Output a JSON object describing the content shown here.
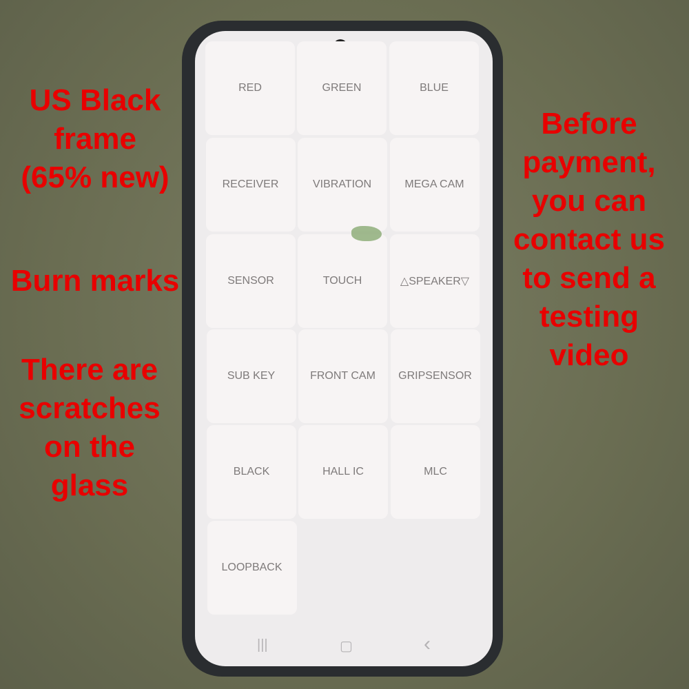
{
  "grid": [
    "RED",
    "GREEN",
    "BLUE",
    "RECEIVER",
    "VIBRATION",
    "MEGA CAM",
    "SENSOR",
    "TOUCH",
    "△SPEAKER▽",
    "SUB KEY",
    "FRONT CAM",
    "GRIPSENSOR",
    "BLACK",
    "HALL IC",
    "MLC",
    "LOOPBACK"
  ],
  "nav": {
    "recents": "|||",
    "home": "▢",
    "back": "‹"
  },
  "notes": {
    "frame": [
      "US Black",
      "frame",
      "(65% new)"
    ],
    "burn": "Burn marks",
    "scratches": [
      "There are",
      "scratches",
      "on the",
      "glass"
    ],
    "payment": [
      "Before",
      "payment,",
      "you can",
      "contact us",
      "to send a",
      "testing",
      "video"
    ]
  },
  "colors": {
    "annotation": "#e80000",
    "tile": "#f7f4f4",
    "tile_text": "#7e7a7a"
  }
}
